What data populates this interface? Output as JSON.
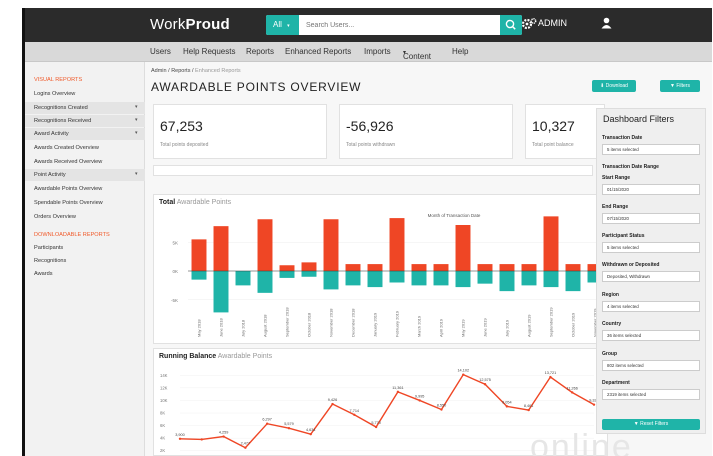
{
  "app": {
    "logo_text": "WorkProud"
  },
  "search": {
    "scope_label": "All",
    "placeholder": "Search Users..."
  },
  "user": {
    "role_label": "ADMIN"
  },
  "nav": {
    "items": [
      "Users",
      "Help Requests",
      "Reports",
      "Enhanced Reports",
      "Imports",
      "Content",
      "Help"
    ]
  },
  "sidebar": {
    "visual_heading": "VISUAL REPORTS",
    "items": [
      {
        "label": "Logins Overview",
        "expandable": false
      },
      {
        "label": "Recognitions Created",
        "expandable": true
      },
      {
        "label": "Recognitions Received",
        "expandable": true
      },
      {
        "label": "Award Activity",
        "expandable": true
      },
      {
        "label": "Awards Created Overview",
        "expandable": false
      },
      {
        "label": "Awards Received Overview",
        "expandable": false
      },
      {
        "label": "Point Activity",
        "expandable": true
      },
      {
        "label": "Awardable Points Overview",
        "expandable": false
      },
      {
        "label": "Spendable Points Overview",
        "expandable": false
      },
      {
        "label": "Orders Overview",
        "expandable": false
      }
    ],
    "downloadable_heading": "DOWNLOADABLE REPORTS",
    "downloadable_items": [
      "Participants",
      "Recognitions",
      "Awards"
    ]
  },
  "breadcrumb": {
    "items": [
      "Admin",
      "Reports",
      "Enhanced Reports"
    ],
    "separator": "/"
  },
  "page": {
    "title": "AWARDABLE POINTS OVERVIEW",
    "download_label": "Download",
    "filters_label": "Filters"
  },
  "stats": [
    {
      "value": "67,253",
      "label": "Total points deposited"
    },
    {
      "value": "-56,926",
      "label": "Total points withdrawn"
    },
    {
      "value": "10,327",
      "label": "Total point balance"
    }
  ],
  "chart_data": [
    {
      "type": "bar",
      "title": "Total",
      "subtitle": "Awardable Points",
      "legend": "Month of Transaction Date",
      "y_ticks": [
        "5K",
        "0K",
        "-5K"
      ],
      "ylim": [
        -8000,
        8000
      ],
      "categories": [
        "May 2018",
        "June 2018",
        "July 2018",
        "August 2018",
        "September 2018",
        "October 2018",
        "November 2018",
        "December 2018",
        "January 2019",
        "February 2019",
        "March 2019",
        "April 2019",
        "May 2019",
        "June 2019",
        "July 2019",
        "August 2019",
        "September 2019",
        "October 2019",
        "November 2019"
      ],
      "series": [
        {
          "values": [
            5500,
            7800,
            0,
            9000,
            1000,
            1500,
            9000,
            1200,
            1200,
            9200,
            1200,
            1200,
            8000,
            1200,
            1200,
            1200,
            9500,
            1200,
            1200
          ]
        },
        {
          "values": [
            -1500,
            -7200,
            -2500,
            -3800,
            -1200,
            -1000,
            -3200,
            -2500,
            -2800,
            -2000,
            -2500,
            -2500,
            -2800,
            -2200,
            -3500,
            -2500,
            -2800,
            -3500,
            -2000
          ]
        }
      ],
      "colors": [
        "#ef4625",
        "#1fb4a8"
      ]
    },
    {
      "type": "line",
      "title": "Running Balance",
      "subtitle": "Awardable Points",
      "y_ticks": [
        "14K",
        "12K",
        "10K",
        "8K",
        "6K",
        "4K",
        "2K"
      ],
      "ylim": [
        1000,
        15000
      ],
      "values": [
        3900,
        3800,
        4259,
        2477,
        6297,
        5579,
        4634,
        9426,
        7714,
        5770,
        11361,
        9995,
        8550,
        14102,
        12575,
        9054,
        8461,
        13721,
        11266,
        9327
      ],
      "labels": [
        "3,900",
        "",
        "4,259",
        "2,477",
        "6,297",
        "5,579",
        "4,634",
        "9,426",
        "7,714",
        "5,770",
        "11,361",
        "9,995",
        "8,550",
        "14,102",
        "12,575",
        "9,054",
        "8,461",
        "13,721",
        "11,266",
        "9,327"
      ],
      "colors": [
        "#ef4625"
      ]
    }
  ],
  "filters": {
    "title": "Dashboard Filters",
    "transaction_date_label": "Transaction Date",
    "transaction_date_value": "5 items selected",
    "range_label": "Transaction Date Range",
    "start_label": "Start Range",
    "start_value": "01/15/2020",
    "end_label": "End Range",
    "end_value": "07/15/2020",
    "status_label": "Participant Status",
    "status_value": "5 items selected",
    "type_label": "Withdrawn or Deposited",
    "type_value": "Deposited, Withdrawn",
    "region_label": "Region",
    "region_value": "4 items selected",
    "country_label": "Country",
    "country_value": "36 items selected",
    "group_label": "Group",
    "group_value": "802 items selected",
    "department_label": "Department",
    "department_value": "2319 items selected",
    "reset_label": "Reset Filters"
  },
  "watermark": {
    "text": "online"
  },
  "colors": {
    "accent": "#1fb4a8",
    "orange": "#ef4625",
    "topbar": "#2b2b2b"
  }
}
